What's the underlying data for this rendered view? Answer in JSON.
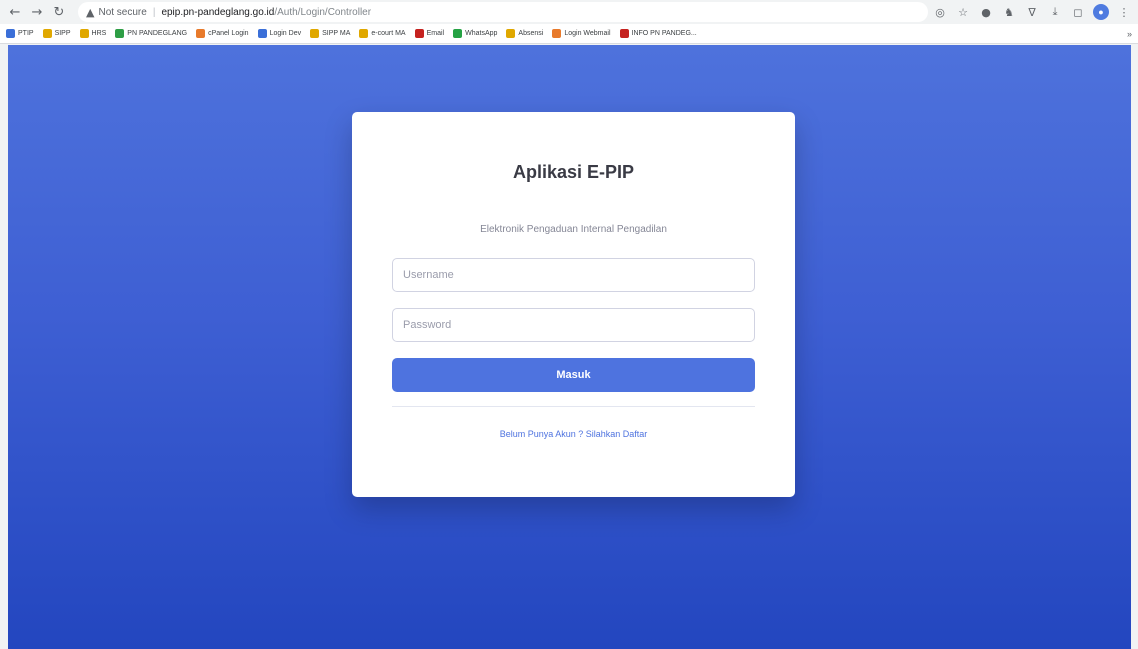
{
  "browser": {
    "security_label": "Not secure",
    "url_host": "epip.pn-pandeglang.go.id",
    "url_path": "/Auth/Login/Controller",
    "icons": [
      "back-icon",
      "forward-icon",
      "reload-icon",
      "warning-icon",
      "google-lens-icon",
      "star-icon",
      "extension-icon",
      "extension-icon",
      "extension-icon",
      "download-icon",
      "tab-icon",
      "profile-icon",
      "menu-icon"
    ]
  },
  "bookmarks": [
    {
      "label": "PTIP",
      "color": "#3b6fd8"
    },
    {
      "label": "SIPP",
      "color": "#e0a800"
    },
    {
      "label": "HRS",
      "color": "#e0a800"
    },
    {
      "label": "PN PANDEGLANG",
      "color": "#2e9e45"
    },
    {
      "label": "cPanel Login",
      "color": "#e87a2b"
    },
    {
      "label": "Login Dev",
      "color": "#3b6fd8"
    },
    {
      "label": "SIPP MA",
      "color": "#e0a800"
    },
    {
      "label": "e-court MA",
      "color": "#e0a800"
    },
    {
      "label": "Email",
      "color": "#c5221f"
    },
    {
      "label": "WhatsApp",
      "color": "#25a244"
    },
    {
      "label": "Absensi",
      "color": "#e0a800"
    },
    {
      "label": "Login Webmail",
      "color": "#e87a2b"
    },
    {
      "label": "INFO PN PANDEG...",
      "color": "#c5221f"
    }
  ],
  "card": {
    "title": "Aplikasi E-PIP",
    "subtitle": "Elektronik Pengaduan Internal Pengadilan",
    "username_placeholder": "Username",
    "password_placeholder": "Password",
    "submit_label": "Masuk",
    "register_link": "Belum Punya Akun ? Silahkan Daftar"
  },
  "colors": {
    "primary": "#4e73df",
    "background_top": "#4e72dc",
    "background_bottom": "#2346bf"
  }
}
